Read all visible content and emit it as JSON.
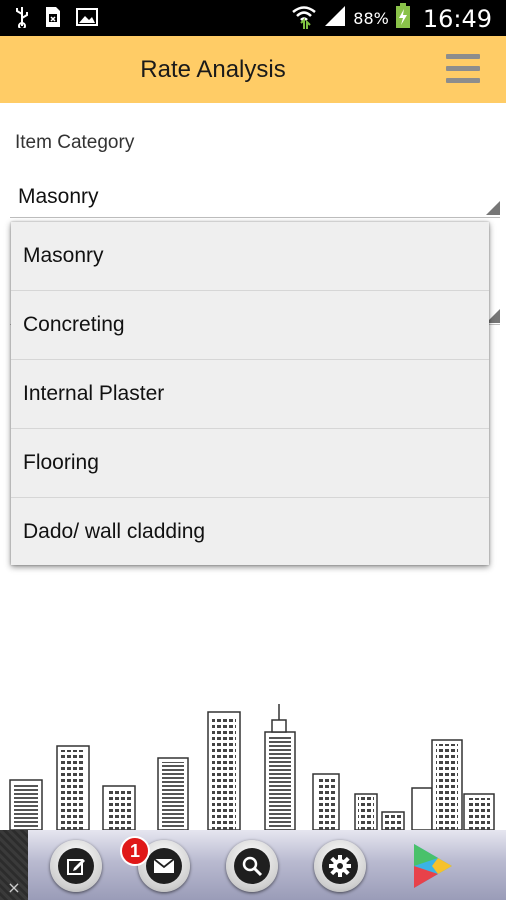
{
  "status_bar": {
    "battery_percent": "88%",
    "time": "16:49",
    "icons": [
      "usb-icon",
      "sd-card-icon",
      "image-icon",
      "wifi-icon",
      "signal-icon",
      "battery-charging-icon"
    ]
  },
  "app_bar": {
    "title": "Rate Analysis",
    "menu_icon": "hamburger-menu-icon",
    "background_color": "#ffcc66"
  },
  "form": {
    "category_label": "Item Category",
    "category_selected": "Masonry"
  },
  "dropdown": {
    "options": [
      "Masonry",
      "Concreting",
      "Internal Plaster",
      "Flooring",
      "Dado/ wall cladding"
    ]
  },
  "bottom_bar": {
    "buttons": [
      "edit-icon",
      "mail-icon",
      "search-icon",
      "settings-icon",
      "play-store-icon"
    ],
    "mail_badge": "1",
    "close_label": "×"
  }
}
